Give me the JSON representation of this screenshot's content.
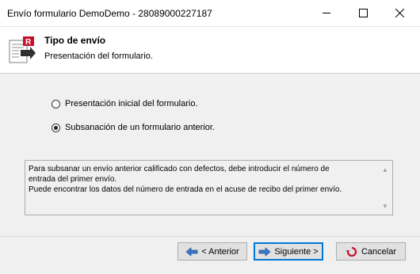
{
  "window": {
    "title": "Envío formulario DemoDemo - 28089000227187"
  },
  "header": {
    "title": "Tipo de envío",
    "subtitle": "Presentación del formulario."
  },
  "options": [
    {
      "label": "Presentación inicial del formulario.",
      "selected": false
    },
    {
      "label": "Subsanación de un formulario anterior.",
      "selected": true
    }
  ],
  "info_text": {
    "lines": [
      "Para subsanar un envío anterior calificado con defectos, debe introducir el número de",
      "entrada del primer envío.",
      "Puede encontrar los datos del número de entrada en el acuse de recibo del primer envío."
    ]
  },
  "buttons": {
    "prev": "< Anterior",
    "next": "Siguiente >",
    "cancel": "Cancelar"
  },
  "colors": {
    "focus_border": "#0078d7",
    "icon_red": "#c8102e"
  },
  "icons": {
    "prev": "arrow-left-icon",
    "next": "arrow-right-icon",
    "cancel": "cancel-icon",
    "header": "form-send-icon"
  }
}
